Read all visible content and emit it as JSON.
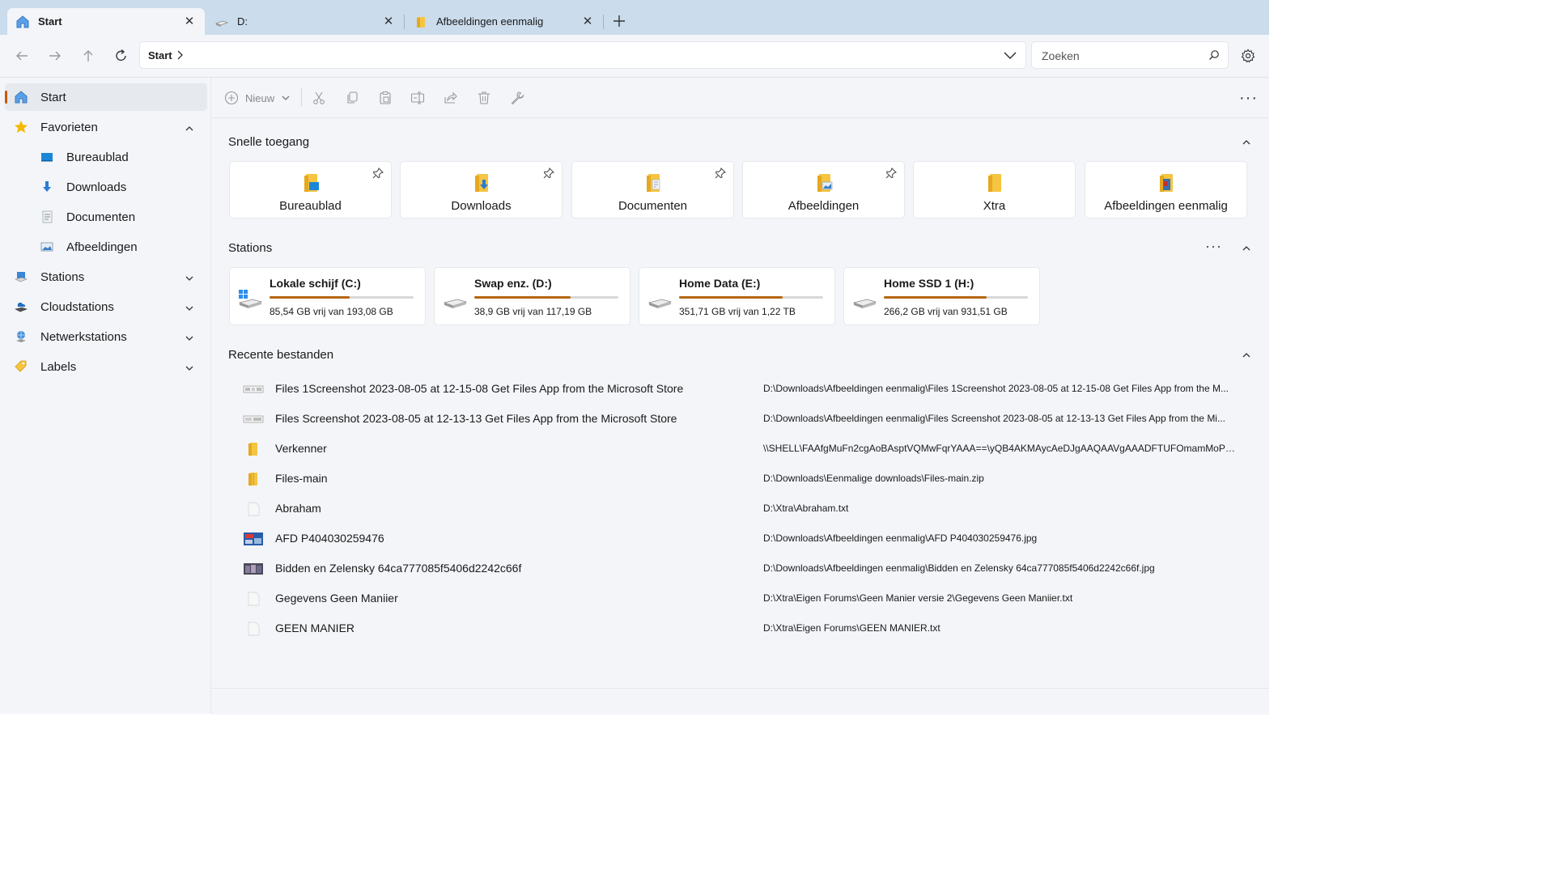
{
  "tabs": [
    {
      "label": "Start",
      "icon": "home-icon",
      "active": true
    },
    {
      "label": "D:",
      "icon": "drive-icon",
      "active": false
    },
    {
      "label": "Afbeeldingen  eenmalig",
      "icon": "folder-icon",
      "active": false
    }
  ],
  "address": {
    "crumb": "Start"
  },
  "search": {
    "placeholder": "Zoeken"
  },
  "sidebar": {
    "items": [
      {
        "label": "Start",
        "icon": "home-icon"
      },
      {
        "label": "Favorieten",
        "icon": "star-icon"
      },
      {
        "label": "Bureaublad",
        "icon": "desktop-icon"
      },
      {
        "label": "Downloads",
        "icon": "download-icon"
      },
      {
        "label": "Documenten",
        "icon": "document-icon"
      },
      {
        "label": "Afbeeldingen",
        "icon": "pictures-icon"
      },
      {
        "label": "Stations",
        "icon": "stations-icon"
      },
      {
        "label": "Cloudstations",
        "icon": "cloud-drive-icon"
      },
      {
        "label": "Netwerkstations",
        "icon": "network-icon"
      },
      {
        "label": "Labels",
        "icon": "tag-icon"
      }
    ]
  },
  "toolbar": {
    "new_label": "Nieuw"
  },
  "sections": {
    "quick": "Snelle toegang",
    "drives": "Stations",
    "recent": "Recente bestanden"
  },
  "quick_access": [
    {
      "label": "Bureaublad",
      "pinned": true
    },
    {
      "label": "Downloads",
      "pinned": true
    },
    {
      "label": "Documenten",
      "pinned": true
    },
    {
      "label": "Afbeeldingen",
      "pinned": true
    },
    {
      "label": "Xtra",
      "pinned": false
    },
    {
      "label": "Afbeeldingen  eenmalig",
      "pinned": false
    }
  ],
  "drives": [
    {
      "name": "Lokale schijf (C:)",
      "free": "85,54 GB vrij van 193,08 GB",
      "used_fraction": 0.557
    },
    {
      "name": "Swap enz. (D:)",
      "free": "38,9 GB vrij van 117,19 GB",
      "used_fraction": 0.668
    },
    {
      "name": "Home Data (E:)",
      "free": "351,71 GB vrij van 1,22 TB",
      "used_fraction": 0.718
    },
    {
      "name": "Home SSD 1 (H:)",
      "free": "266,2 GB vrij van 931,51 GB",
      "used_fraction": 0.714
    }
  ],
  "recent": [
    {
      "name": "Files 1Screenshot 2023-08-05 at 12-15-08 Get Files App from the Microsoft Store",
      "path": "D:\\Downloads\\Afbeeldingen  eenmalig\\Files 1Screenshot 2023-08-05 at 12-15-08 Get Files App from the M...",
      "icon": "screenshot-icon"
    },
    {
      "name": "Files Screenshot 2023-08-05 at 12-13-13 Get Files App from the Microsoft Store",
      "path": "D:\\Downloads\\Afbeeldingen  eenmalig\\Files Screenshot 2023-08-05 at 12-13-13 Get Files App from the Mi...",
      "icon": "screenshot-icon"
    },
    {
      "name": "Verkenner",
      "path": "\\\\SHELL\\FAAfgMuFn2cgAoBAsptVQMwFqrYAAA==\\yQB4AKMAycAeDJgAAQAAVgAAADFTUFOmamMoPZX...",
      "icon": "folder-icon"
    },
    {
      "name": "Files-main",
      "path": "D:\\Downloads\\Eenmalige downloads\\Files-main.zip",
      "icon": "zip-folder-icon"
    },
    {
      "name": "Abraham",
      "path": "D:\\Xtra\\Abraham.txt",
      "icon": "text-file-icon"
    },
    {
      "name": "AFD P404030259476",
      "path": "D:\\Downloads\\Afbeeldingen  eenmalig\\AFD P404030259476.jpg",
      "icon": "image-thumb-icon"
    },
    {
      "name": "Bidden en Zelensky 64ca777085f5406d2242c66f",
      "path": "D:\\Downloads\\Afbeeldingen  eenmalig\\Bidden en Zelensky 64ca777085f5406d2242c66f.jpg",
      "icon": "image-thumb-icon"
    },
    {
      "name": "Gegevens Geen Maniier",
      "path": "D:\\Xtra\\Eigen Forums\\Geen Manier versie 2\\Gegevens Geen Maniier.txt",
      "icon": "text-file-icon"
    },
    {
      "name": "GEEN MANIER",
      "path": "D:\\Xtra\\Eigen Forums\\GEEN MANIER.txt",
      "icon": "text-file-icon"
    }
  ],
  "colors": {
    "accent": "#c85a0a",
    "drive_bar": "#b5670f",
    "folder": "#f5c542",
    "tabbar": "#cbdcec",
    "surface": "#f3f5f9"
  }
}
